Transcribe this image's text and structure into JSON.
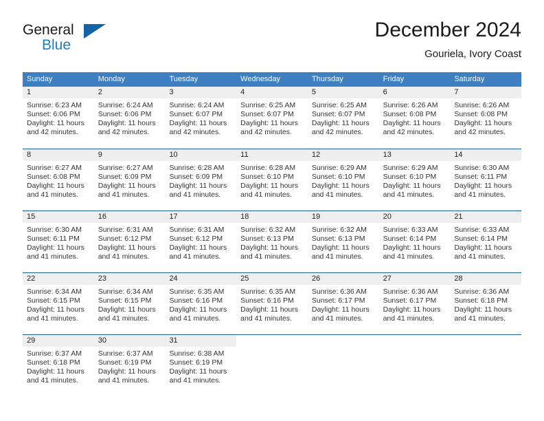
{
  "brand": {
    "line1": "General",
    "line2": "Blue",
    "icon": "triangle-logo",
    "colors": {
      "general": "#1a1a1a",
      "blue": "#1c7fc3",
      "triangle": "#1464a5"
    }
  },
  "header": {
    "title": "December 2024",
    "subtitle": "Gouriela, Ivory Coast"
  },
  "theme": {
    "header_bg": "#3d7fc1",
    "week_border": "#1a5fa0",
    "daynum_bg": "#efefef",
    "text": "#333333"
  },
  "calendar": {
    "weekday_headers": [
      "Sunday",
      "Monday",
      "Tuesday",
      "Wednesday",
      "Thursday",
      "Friday",
      "Saturday"
    ],
    "weeks": [
      [
        {
          "day": "1",
          "sunrise": "Sunrise: 6:23 AM",
          "sunset": "Sunset: 6:06 PM",
          "daylight1": "Daylight: 11 hours",
          "daylight2": "and 42 minutes."
        },
        {
          "day": "2",
          "sunrise": "Sunrise: 6:24 AM",
          "sunset": "Sunset: 6:06 PM",
          "daylight1": "Daylight: 11 hours",
          "daylight2": "and 42 minutes."
        },
        {
          "day": "3",
          "sunrise": "Sunrise: 6:24 AM",
          "sunset": "Sunset: 6:07 PM",
          "daylight1": "Daylight: 11 hours",
          "daylight2": "and 42 minutes."
        },
        {
          "day": "4",
          "sunrise": "Sunrise: 6:25 AM",
          "sunset": "Sunset: 6:07 PM",
          "daylight1": "Daylight: 11 hours",
          "daylight2": "and 42 minutes."
        },
        {
          "day": "5",
          "sunrise": "Sunrise: 6:25 AM",
          "sunset": "Sunset: 6:07 PM",
          "daylight1": "Daylight: 11 hours",
          "daylight2": "and 42 minutes."
        },
        {
          "day": "6",
          "sunrise": "Sunrise: 6:26 AM",
          "sunset": "Sunset: 6:08 PM",
          "daylight1": "Daylight: 11 hours",
          "daylight2": "and 42 minutes."
        },
        {
          "day": "7",
          "sunrise": "Sunrise: 6:26 AM",
          "sunset": "Sunset: 6:08 PM",
          "daylight1": "Daylight: 11 hours",
          "daylight2": "and 42 minutes."
        }
      ],
      [
        {
          "day": "8",
          "sunrise": "Sunrise: 6:27 AM",
          "sunset": "Sunset: 6:08 PM",
          "daylight1": "Daylight: 11 hours",
          "daylight2": "and 41 minutes."
        },
        {
          "day": "9",
          "sunrise": "Sunrise: 6:27 AM",
          "sunset": "Sunset: 6:09 PM",
          "daylight1": "Daylight: 11 hours",
          "daylight2": "and 41 minutes."
        },
        {
          "day": "10",
          "sunrise": "Sunrise: 6:28 AM",
          "sunset": "Sunset: 6:09 PM",
          "daylight1": "Daylight: 11 hours",
          "daylight2": "and 41 minutes."
        },
        {
          "day": "11",
          "sunrise": "Sunrise: 6:28 AM",
          "sunset": "Sunset: 6:10 PM",
          "daylight1": "Daylight: 11 hours",
          "daylight2": "and 41 minutes."
        },
        {
          "day": "12",
          "sunrise": "Sunrise: 6:29 AM",
          "sunset": "Sunset: 6:10 PM",
          "daylight1": "Daylight: 11 hours",
          "daylight2": "and 41 minutes."
        },
        {
          "day": "13",
          "sunrise": "Sunrise: 6:29 AM",
          "sunset": "Sunset: 6:10 PM",
          "daylight1": "Daylight: 11 hours",
          "daylight2": "and 41 minutes."
        },
        {
          "day": "14",
          "sunrise": "Sunrise: 6:30 AM",
          "sunset": "Sunset: 6:11 PM",
          "daylight1": "Daylight: 11 hours",
          "daylight2": "and 41 minutes."
        }
      ],
      [
        {
          "day": "15",
          "sunrise": "Sunrise: 6:30 AM",
          "sunset": "Sunset: 6:11 PM",
          "daylight1": "Daylight: 11 hours",
          "daylight2": "and 41 minutes."
        },
        {
          "day": "16",
          "sunrise": "Sunrise: 6:31 AM",
          "sunset": "Sunset: 6:12 PM",
          "daylight1": "Daylight: 11 hours",
          "daylight2": "and 41 minutes."
        },
        {
          "day": "17",
          "sunrise": "Sunrise: 6:31 AM",
          "sunset": "Sunset: 6:12 PM",
          "daylight1": "Daylight: 11 hours",
          "daylight2": "and 41 minutes."
        },
        {
          "day": "18",
          "sunrise": "Sunrise: 6:32 AM",
          "sunset": "Sunset: 6:13 PM",
          "daylight1": "Daylight: 11 hours",
          "daylight2": "and 41 minutes."
        },
        {
          "day": "19",
          "sunrise": "Sunrise: 6:32 AM",
          "sunset": "Sunset: 6:13 PM",
          "daylight1": "Daylight: 11 hours",
          "daylight2": "and 41 minutes."
        },
        {
          "day": "20",
          "sunrise": "Sunrise: 6:33 AM",
          "sunset": "Sunset: 6:14 PM",
          "daylight1": "Daylight: 11 hours",
          "daylight2": "and 41 minutes."
        },
        {
          "day": "21",
          "sunrise": "Sunrise: 6:33 AM",
          "sunset": "Sunset: 6:14 PM",
          "daylight1": "Daylight: 11 hours",
          "daylight2": "and 41 minutes."
        }
      ],
      [
        {
          "day": "22",
          "sunrise": "Sunrise: 6:34 AM",
          "sunset": "Sunset: 6:15 PM",
          "daylight1": "Daylight: 11 hours",
          "daylight2": "and 41 minutes."
        },
        {
          "day": "23",
          "sunrise": "Sunrise: 6:34 AM",
          "sunset": "Sunset: 6:15 PM",
          "daylight1": "Daylight: 11 hours",
          "daylight2": "and 41 minutes."
        },
        {
          "day": "24",
          "sunrise": "Sunrise: 6:35 AM",
          "sunset": "Sunset: 6:16 PM",
          "daylight1": "Daylight: 11 hours",
          "daylight2": "and 41 minutes."
        },
        {
          "day": "25",
          "sunrise": "Sunrise: 6:35 AM",
          "sunset": "Sunset: 6:16 PM",
          "daylight1": "Daylight: 11 hours",
          "daylight2": "and 41 minutes."
        },
        {
          "day": "26",
          "sunrise": "Sunrise: 6:36 AM",
          "sunset": "Sunset: 6:17 PM",
          "daylight1": "Daylight: 11 hours",
          "daylight2": "and 41 minutes."
        },
        {
          "day": "27",
          "sunrise": "Sunrise: 6:36 AM",
          "sunset": "Sunset: 6:17 PM",
          "daylight1": "Daylight: 11 hours",
          "daylight2": "and 41 minutes."
        },
        {
          "day": "28",
          "sunrise": "Sunrise: 6:36 AM",
          "sunset": "Sunset: 6:18 PM",
          "daylight1": "Daylight: 11 hours",
          "daylight2": "and 41 minutes."
        }
      ],
      [
        {
          "day": "29",
          "sunrise": "Sunrise: 6:37 AM",
          "sunset": "Sunset: 6:18 PM",
          "daylight1": "Daylight: 11 hours",
          "daylight2": "and 41 minutes."
        },
        {
          "day": "30",
          "sunrise": "Sunrise: 6:37 AM",
          "sunset": "Sunset: 6:19 PM",
          "daylight1": "Daylight: 11 hours",
          "daylight2": "and 41 minutes."
        },
        {
          "day": "31",
          "sunrise": "Sunrise: 6:38 AM",
          "sunset": "Sunset: 6:19 PM",
          "daylight1": "Daylight: 11 hours",
          "daylight2": "and 41 minutes."
        },
        {
          "day": "",
          "sunrise": "",
          "sunset": "",
          "daylight1": "",
          "daylight2": ""
        },
        {
          "day": "",
          "sunrise": "",
          "sunset": "",
          "daylight1": "",
          "daylight2": ""
        },
        {
          "day": "",
          "sunrise": "",
          "sunset": "",
          "daylight1": "",
          "daylight2": ""
        },
        {
          "day": "",
          "sunrise": "",
          "sunset": "",
          "daylight1": "",
          "daylight2": ""
        }
      ]
    ]
  }
}
